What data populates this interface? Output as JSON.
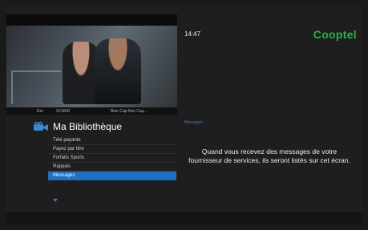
{
  "header": {
    "time": "14:47",
    "logo": "Cooptel"
  },
  "preview": {
    "epg": [
      "Ext",
      "SCAND",
      "Bien Cap Bon Cap..."
    ]
  },
  "library": {
    "title": "Ma Bibliothèque",
    "icon": "film-camera-icon",
    "items": [
      {
        "label": "Télé payante"
      },
      {
        "label": "Payez par titre"
      },
      {
        "label": "Forfaits Sports"
      },
      {
        "label": "Rappels"
      },
      {
        "label": "Messages",
        "selected": true
      }
    ]
  },
  "content": {
    "section_label": "Messages",
    "empty_message": "Quand vous recevez des messages de votre fournisseur de services, ils seront listés sur cet écran."
  },
  "colors": {
    "accent": "#1f6fc2",
    "brand": "#27b14a",
    "background": "#1e1e1e"
  }
}
